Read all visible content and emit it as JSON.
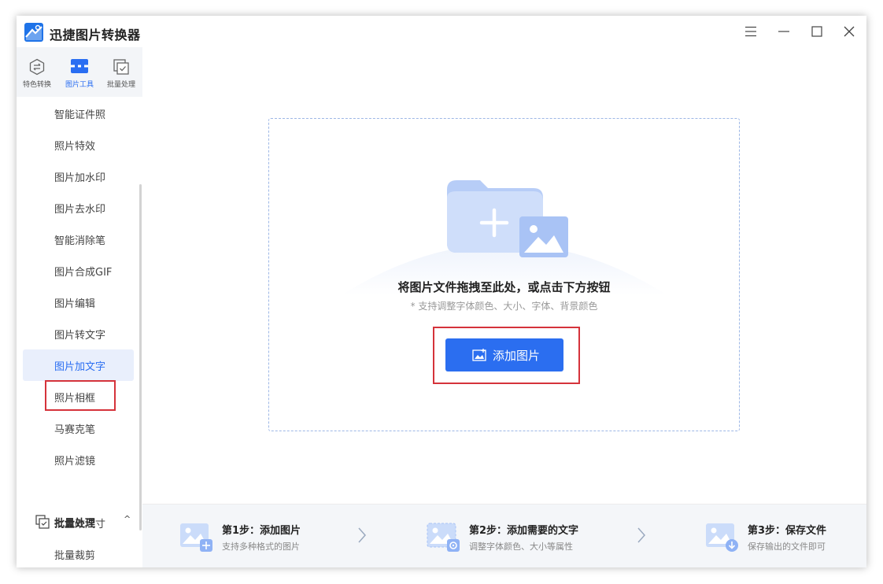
{
  "app": {
    "title": "迅捷图片转换器"
  },
  "colors": {
    "accent": "#2b6ef0",
    "highlight": "#d5333b",
    "sidebar_active_bg": "#e9effc"
  },
  "sidebar": {
    "tabs": [
      {
        "label": "特色转换",
        "icon": "convert-icon"
      },
      {
        "label": "图片工具",
        "icon": "image-tools-icon",
        "active": true
      },
      {
        "label": "批量处理",
        "icon": "batch-icon"
      }
    ],
    "items": [
      {
        "label": "智能证件照"
      },
      {
        "label": "照片特效"
      },
      {
        "label": "图片加水印"
      },
      {
        "label": "图片去水印"
      },
      {
        "label": "智能消除笔"
      },
      {
        "label": "图片合成GIF"
      },
      {
        "label": "图片编辑"
      },
      {
        "label": "图片转文字"
      },
      {
        "label": "图片加文字",
        "active": true
      },
      {
        "label": "照片相框"
      },
      {
        "label": "马赛克笔"
      },
      {
        "label": "照片滤镜"
      }
    ],
    "batch_section": {
      "label": "批量处理",
      "caret": "^",
      "items": [
        {
          "label": "批量改尺寸"
        },
        {
          "label": "批量裁剪"
        }
      ]
    }
  },
  "dropzone": {
    "title": "将图片文件拖拽至此处，或点击下方按钮",
    "subtitle": "* 支持调整字体颜色、大小、字体、背景颜色",
    "button_label": "添加图片"
  },
  "steps": [
    {
      "title": "第1步：添加图片",
      "desc": "支持多种格式的图片",
      "icon": "add-image-step-icon"
    },
    {
      "title": "第2步：添加需要的文字",
      "desc": "调整字体颜色、大小等属性",
      "icon": "settings-step-icon"
    },
    {
      "title": "第3步：保存文件",
      "desc": "保存输出的文件即可",
      "icon": "download-step-icon"
    }
  ]
}
